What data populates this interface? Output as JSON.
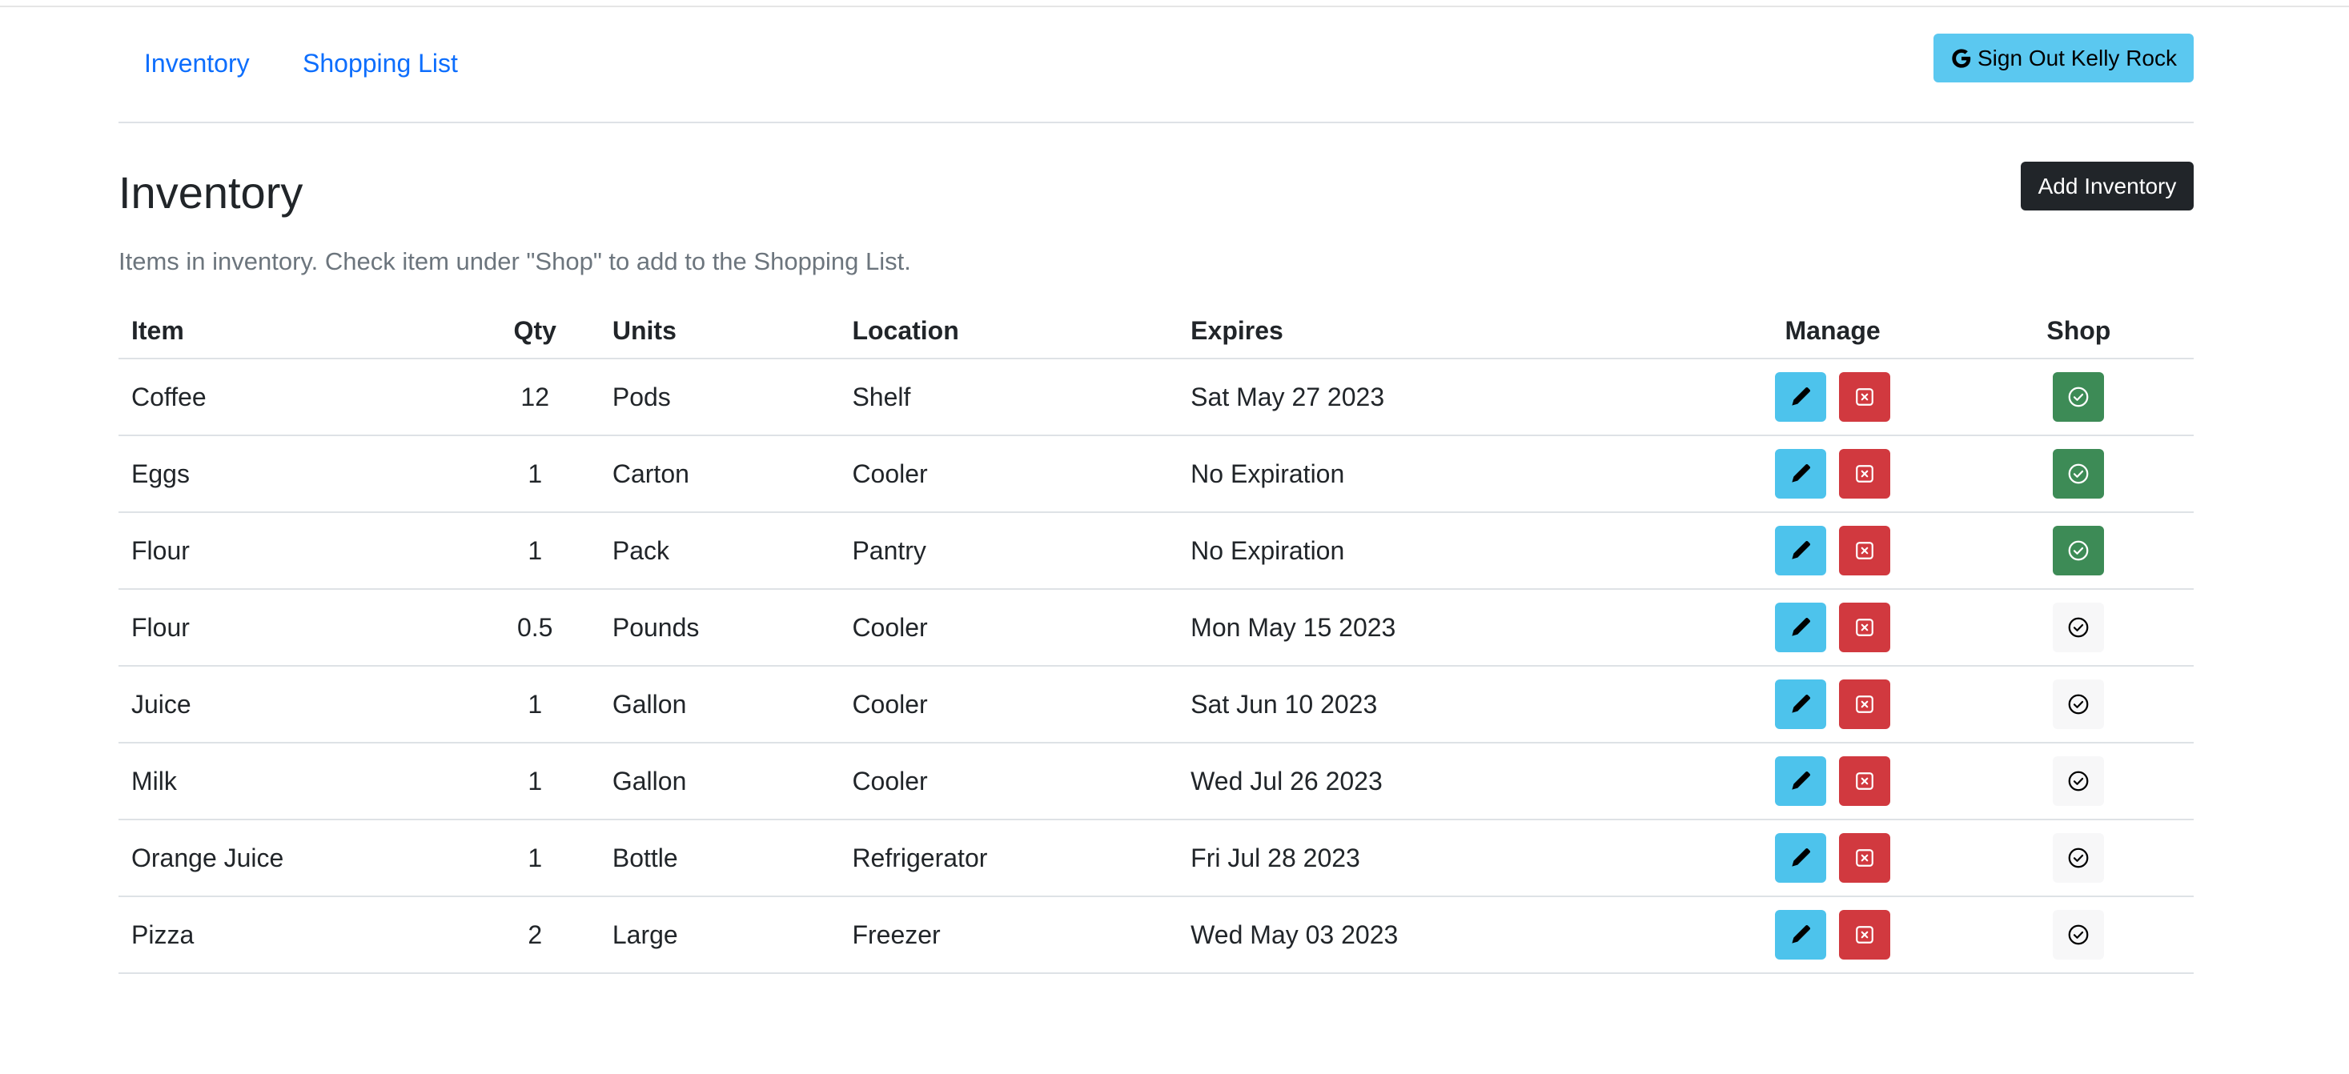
{
  "nav": {
    "links": [
      "Inventory",
      "Shopping List"
    ],
    "signout_label": "Sign Out Kelly Rock"
  },
  "page": {
    "title": "Inventory",
    "add_button": "Add Inventory",
    "subtitle": "Items in inventory. Check item under \"Shop\" to add to the Shopping List."
  },
  "table": {
    "headers": [
      "Item",
      "Qty",
      "Units",
      "Location",
      "Expires",
      "Manage",
      "Shop"
    ],
    "rows": [
      {
        "item": "Coffee",
        "qty": "12",
        "units": "Pods",
        "location": "Shelf",
        "expires": "Sat May 27 2023",
        "shop": true
      },
      {
        "item": "Eggs",
        "qty": "1",
        "units": "Carton",
        "location": "Cooler",
        "expires": "No Expiration",
        "shop": true
      },
      {
        "item": "Flour",
        "qty": "1",
        "units": "Pack",
        "location": "Pantry",
        "expires": "No Expiration",
        "shop": true
      },
      {
        "item": "Flour",
        "qty": "0.5",
        "units": "Pounds",
        "location": "Cooler",
        "expires": "Mon May 15 2023",
        "shop": false
      },
      {
        "item": "Juice",
        "qty": "1",
        "units": "Gallon",
        "location": "Cooler",
        "expires": "Sat Jun 10 2023",
        "shop": false
      },
      {
        "item": "Milk",
        "qty": "1",
        "units": "Gallon",
        "location": "Cooler",
        "expires": "Wed Jul 26 2023",
        "shop": false
      },
      {
        "item": "Orange Juice",
        "qty": "1",
        "units": "Bottle",
        "location": "Refrigerator",
        "expires": "Fri Jul 28 2023",
        "shop": false
      },
      {
        "item": "Pizza",
        "qty": "2",
        "units": "Large",
        "location": "Freezer",
        "expires": "Wed May 03 2023",
        "shop": false
      }
    ]
  },
  "icons": {
    "edit": "pencil-icon",
    "delete": "x-square-icon",
    "shop": "check-circle-icon",
    "signout": "google-icon"
  },
  "colors": {
    "link": "#0d6efd",
    "info": "#5bc8f0",
    "danger": "#d1393f",
    "success": "#3d8b56",
    "dark": "#212529"
  }
}
